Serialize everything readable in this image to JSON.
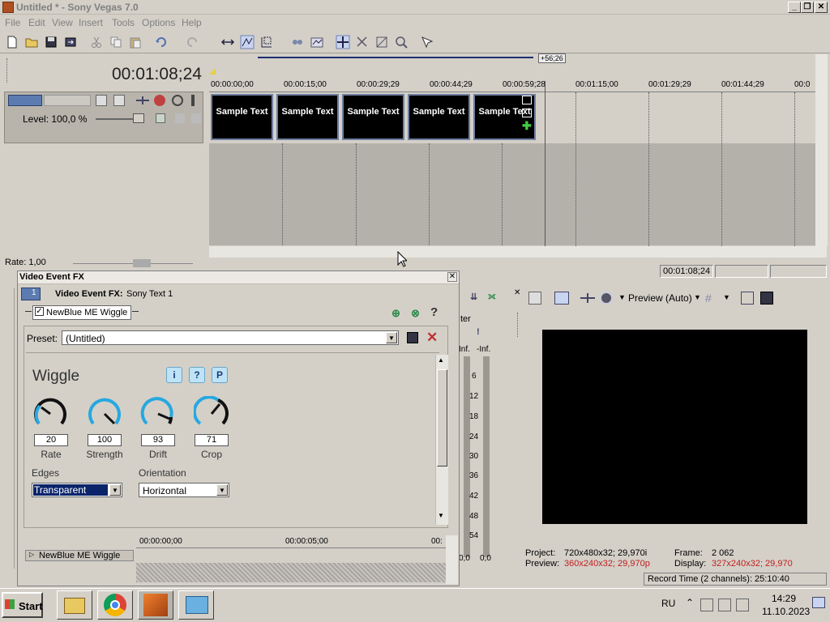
{
  "window": {
    "title": "Untitled * - Sony Vegas 7.0"
  },
  "menu": [
    "File",
    "Edit",
    "View",
    "Insert",
    "Tools",
    "Options",
    "Help"
  ],
  "main_timecode": "00:01:08;24",
  "track": {
    "level": "Level: 100,0 %"
  },
  "ruler": {
    "marks": [
      "00:00:00;00",
      "00:00:15;00",
      "00:00:29;29",
      "00:00:44;29",
      "00:00:59;28",
      "00:01:15;00",
      "00:01:29;29",
      "00:01:44;29",
      "00:0"
    ]
  },
  "region_badge": "+56;26",
  "clips": [
    "Sample Text",
    "Sample Text",
    "Sample Text",
    "Sample Text",
    "Sample Text"
  ],
  "rate": "Rate: 1,00",
  "status_timecode": "00:01:08;24",
  "fx": {
    "window_title": "Video Event FX",
    "header_label": "Video Event FX:",
    "header_value": "Sony Text 1",
    "chain_item": "NewBlue ME Wiggle",
    "preset_label": "Preset:",
    "preset_value": "(Untitled)",
    "plugin_title": "Wiggle",
    "info_btns": [
      "i",
      "?",
      "P"
    ],
    "knobs": [
      {
        "label": "Rate",
        "value": "20"
      },
      {
        "label": "Strength",
        "value": "100"
      },
      {
        "label": "Drift",
        "value": "93"
      },
      {
        "label": "Crop",
        "value": "71"
      }
    ],
    "edges_label": "Edges",
    "edges_value": "Transparent",
    "orientation_label": "Orientation",
    "orientation_value": "Horizontal",
    "kf_times": [
      "00:00:00;00",
      "00:00:05;00",
      "00:"
    ],
    "kf_track": "NewBlue ME Wiggle"
  },
  "meter": {
    "header": "ter",
    "cap_left": "Inf.",
    "cap_right": "-Inf.",
    "scale": [
      "6",
      "12",
      "18",
      "24",
      "30",
      "36",
      "42",
      "48",
      "54"
    ],
    "bottom_left": "0,0",
    "bottom_right": "0,0"
  },
  "preview": {
    "mode": "Preview (Auto)",
    "project_label": "Project:",
    "project_value": "720x480x32; 29,970i",
    "preview_label": "Preview:",
    "preview_value": "360x240x32; 29,970p",
    "frame_label": "Frame:",
    "frame_value": "2 062",
    "display_label": "Display:",
    "display_value": "327x240x32; 29,970"
  },
  "record_time": "Record Time (2 channels): 25:10:40",
  "taskbar": {
    "start": "Start",
    "lang": "RU",
    "time": "14:29",
    "date": "11.10.2023"
  }
}
